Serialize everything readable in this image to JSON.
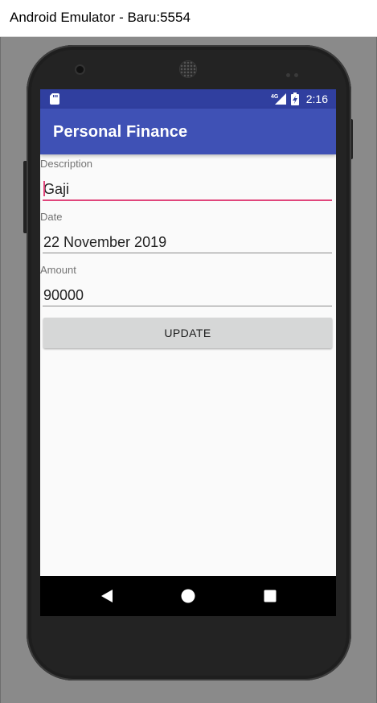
{
  "window": {
    "title": "Android Emulator - Baru:5554"
  },
  "status_bar": {
    "time": "2:16",
    "network": "4G",
    "icons": [
      "sd-card-icon",
      "signal-icon",
      "battery-icon"
    ],
    "color": "#303f9f"
  },
  "app_bar": {
    "title": "Personal Finance",
    "color": "#3f51b5"
  },
  "form": {
    "description": {
      "label": "Description",
      "value": "Gaji"
    },
    "date": {
      "label": "Date",
      "value": "22 November 2019"
    },
    "amount": {
      "label": "Amount",
      "value": "90000"
    },
    "update_button": "UPDATE",
    "accent_color": "#e0457b"
  },
  "nav_bar": {
    "icons": [
      "back-icon",
      "home-icon",
      "recents-icon"
    ]
  }
}
